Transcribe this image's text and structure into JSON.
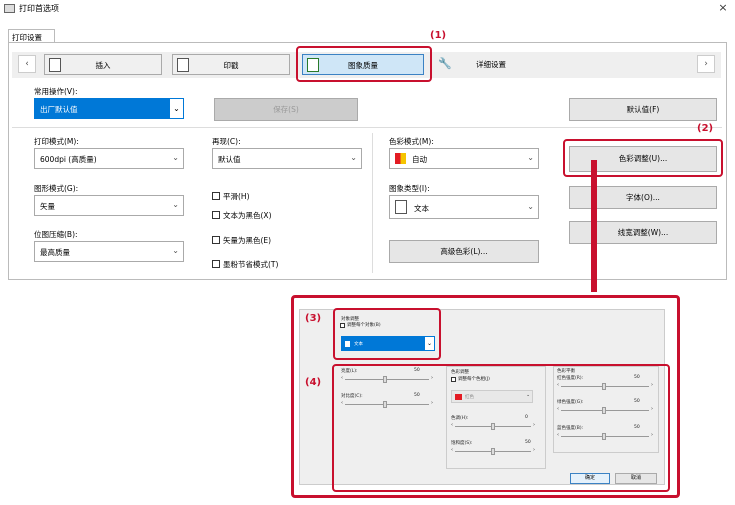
{
  "window": {
    "title": "打印首选项",
    "close": "×"
  },
  "tab": "打印设置",
  "nav": {
    "left": "‹",
    "right": "›",
    "items": [
      {
        "label": "插入"
      },
      {
        "label": "印戳"
      },
      {
        "label": "图象质量"
      },
      {
        "label": "详细设置"
      }
    ]
  },
  "common_ops": {
    "label": "常用操作(V):",
    "value": "出厂默认值",
    "save": "保存(S)",
    "defaults": "默认值(F)"
  },
  "print_mode": {
    "label": "打印模式(M):",
    "value": "600dpi (高质量)"
  },
  "reproduce": {
    "label": "再现(C):",
    "value": "默认值"
  },
  "color_mode": {
    "label": "色彩模式(M):",
    "value": "自动"
  },
  "graphics_mode": {
    "label": "图形模式(G):",
    "value": "矢量"
  },
  "image_type": {
    "label": "图象类型(I):",
    "value": "文本"
  },
  "bitmap": {
    "label": "位图压缩(B):",
    "value": "最高质量"
  },
  "checks": [
    "平滑(H)",
    "文本为黑色(X)",
    "矢量为黑色(E)",
    "墨粉节省模式(T)"
  ],
  "buttons": {
    "color_adjust": "色彩调整(U)...",
    "font": "字体(O)...",
    "line_width": "线宽调整(W)...",
    "advanced_color": "高级色彩(L)..."
  },
  "annotations": [
    "(1)",
    "(2)",
    "(3)",
    "(4)"
  ],
  "sub": {
    "target_title": "对象调整",
    "target_check": "调整每个对象(B)",
    "target_value": "文本",
    "brightness": "亮度(L):",
    "brightness_val": "50",
    "contrast": "对比度(C):",
    "contrast_val": "50",
    "color_adjust_title": "色彩调整",
    "color_adjust_check": "调整每个色相(J)",
    "hue_color": "红色",
    "hue": "色调(H):",
    "hue_val": "0",
    "saturation": "饱和度(S):",
    "saturation_val": "50",
    "balance_title": "色彩平衡",
    "red": "红色强度(R):",
    "red_val": "50",
    "green": "绿色强度(G):",
    "green_val": "50",
    "blue": "蓝色强度(B):",
    "blue_val": "50",
    "ok": "确定",
    "cancel": "取消",
    "la": "‹",
    "ra": "›"
  }
}
